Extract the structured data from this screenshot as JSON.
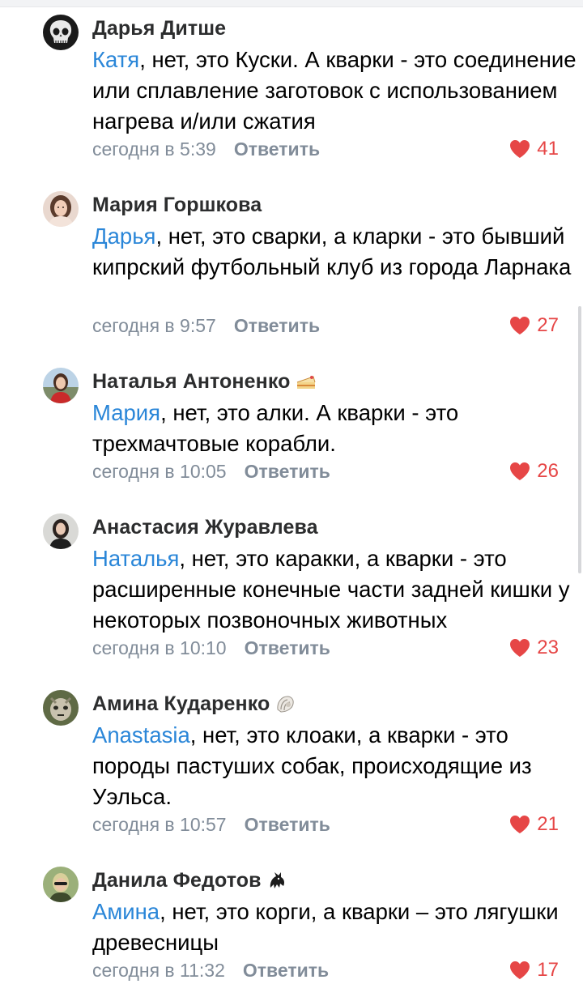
{
  "comments": [
    {
      "author": "Дарья Дитше",
      "mention": "Катя",
      "text": ", нет, это Куски. А кварки - это соединение или сплавление заготовок с использованием нагрева и/или сжатия",
      "time": "сегодня в 5:39",
      "reply": "Ответить",
      "likes": "41",
      "avatar": "skull-avatar",
      "emoji": ""
    },
    {
      "author": "Мария Горшкова",
      "mention": "Дарья",
      "text": ", нет, это сварки, а кларки - это бывший кипрский футбольный клуб из города Ларнака",
      "time": "сегодня в 9:57",
      "reply": "Ответить",
      "likes": "27",
      "avatar": "photo-avatar",
      "emoji": ""
    },
    {
      "author": "Наталья Антоненко",
      "mention": "Мария",
      "text": ", нет, это алки. А кварки - это трехмачтовые корабли.",
      "time": "сегодня в 10:05",
      "reply": "Ответить",
      "likes": "26",
      "avatar": "photo-avatar",
      "emoji": "cake-icon"
    },
    {
      "author": "Анастасия Журавлева",
      "mention": "Наталья",
      "text": ", нет, это каракки, а кварки - это расширенные конечные части задней кишки у некоторых позвоночных животных",
      "time": "сегодня в 10:10",
      "reply": "Ответить",
      "likes": "23",
      "avatar": "photo-avatar",
      "emoji": ""
    },
    {
      "author": "Амина Кударенко",
      "mention": "Anastasia",
      "text": ", нет, это клоаки, а кварки - это породы пастуших собак, происходящие из Уэльса.",
      "time": "сегодня в 10:57",
      "reply": "Ответить",
      "likes": "21",
      "avatar": "photo-avatar",
      "emoji": "shell-icon"
    },
    {
      "author": "Данила Федотов",
      "mention": "Амина",
      "text": ", нет, это корги, а кварки – это лягушки древесницы",
      "time": "сегодня в 11:32",
      "reply": "Ответить",
      "likes": "17",
      "avatar": "photo-avatar",
      "emoji": "dragon-icon"
    }
  ],
  "colors": {
    "mention": "#2a86d8",
    "meta": "#818c99",
    "like": "#e64646"
  }
}
